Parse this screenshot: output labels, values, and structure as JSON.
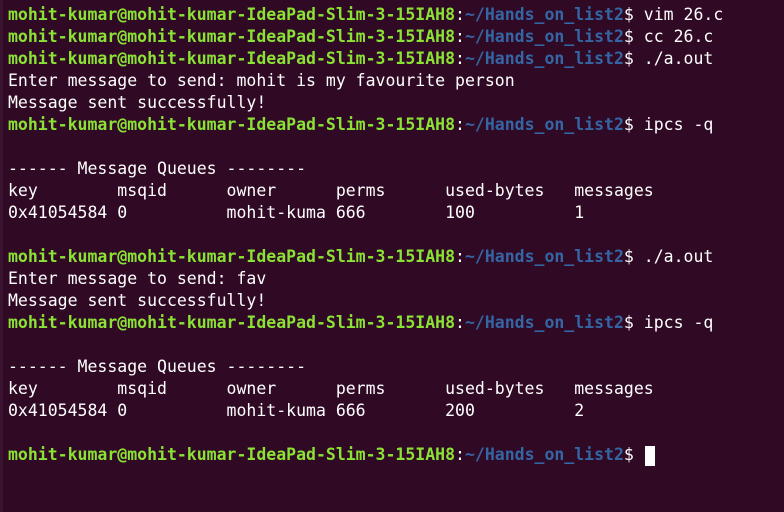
{
  "prompt": {
    "user_host": "mohit-kumar@mohit-kumar-IdeaPad-Slim-3-15IAH8",
    "separator": ":",
    "path": "~/Hands_on_list2",
    "symbol": "$ "
  },
  "lines": [
    {
      "kind": "prompt",
      "command": "vim 26.c"
    },
    {
      "kind": "prompt",
      "command": "cc 26.c"
    },
    {
      "kind": "prompt",
      "command": "./a.out"
    },
    {
      "kind": "output",
      "text": "Enter message to send: mohit is my favourite person"
    },
    {
      "kind": "output",
      "text": "Message sent successfully!"
    },
    {
      "kind": "prompt",
      "command": "ipcs -q"
    },
    {
      "kind": "output",
      "text": ""
    },
    {
      "kind": "output",
      "text": "------ Message Queues --------"
    },
    {
      "kind": "output",
      "text": "key        msqid      owner      perms      used-bytes   messages"
    },
    {
      "kind": "output",
      "text": "0x41054584 0          mohit-kuma 666        100          1"
    },
    {
      "kind": "output",
      "text": ""
    },
    {
      "kind": "prompt",
      "command": "./a.out"
    },
    {
      "kind": "output",
      "text": "Enter message to send: fav"
    },
    {
      "kind": "output",
      "text": "Message sent successfully!"
    },
    {
      "kind": "prompt",
      "command": "ipcs -q"
    },
    {
      "kind": "output",
      "text": ""
    },
    {
      "kind": "output",
      "text": "------ Message Queues --------"
    },
    {
      "kind": "output",
      "text": "key        msqid      owner      perms      used-bytes   messages"
    },
    {
      "kind": "output",
      "text": "0x41054584 0          mohit-kuma 666        200          2"
    },
    {
      "kind": "output",
      "text": ""
    },
    {
      "kind": "prompt",
      "command": "",
      "cursor": true
    }
  ],
  "colors": {
    "background": "#300a24",
    "user_host": "#8ae234",
    "path": "#3465a4",
    "text": "#ffffff"
  }
}
